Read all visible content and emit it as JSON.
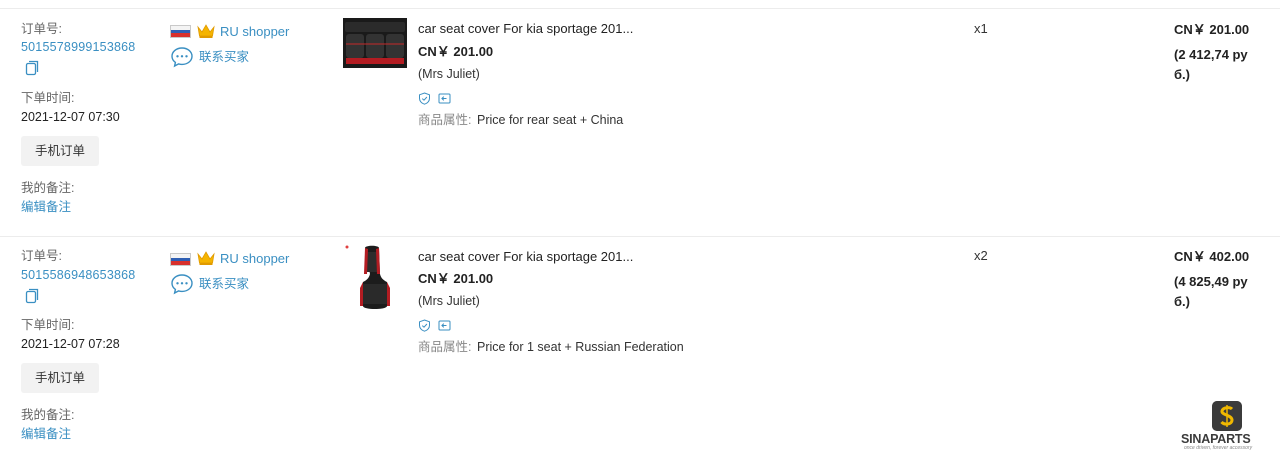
{
  "labels": {
    "order_no": "订单号:",
    "order_time": "下单时间:",
    "mobile_order": "手机订单",
    "my_note": "我的备注:",
    "edit_note": "编辑备注",
    "contact_buyer": "联系买家",
    "attr_label": "商品属性:"
  },
  "orders": [
    {
      "id": "5015578999153868",
      "time": "2021-12-07 07:30",
      "shopper": "RU shopper",
      "product": {
        "title": "car seat cover For kia sportage 201...",
        "price": "CN￥ 201.00",
        "seller": "(Mrs Juliet)",
        "attr": "Price for rear seat + China"
      },
      "qty": "x1",
      "total": "CN￥ 201.00",
      "total_rub": "(2 412,74 ру б.)"
    },
    {
      "id": "5015586948653868",
      "time": "2021-12-07 07:28",
      "shopper": "RU shopper",
      "product": {
        "title": "car seat cover For kia sportage 201...",
        "price": "CN￥ 201.00",
        "seller": "(Mrs Juliet)",
        "attr": "Price for 1 seat + Russian Federation"
      },
      "qty": "x2",
      "total": "CN￥ 402.00",
      "total_rub": "(4 825,49 ру б.)"
    }
  ],
  "icons": {
    "flag": "russia-flag-icon",
    "crown": "crown-icon",
    "chat": "chat-bubble-icon",
    "copy": "copy-icon",
    "shield": "shield-check-icon",
    "return": "return-icon"
  },
  "colors": {
    "link": "#3a8fc2",
    "crown": "#f5b400",
    "button_bg": "#f2f2f2"
  },
  "watermark": {
    "name": "SINAPARTS",
    "tagline": "once driven, forever accessory"
  }
}
